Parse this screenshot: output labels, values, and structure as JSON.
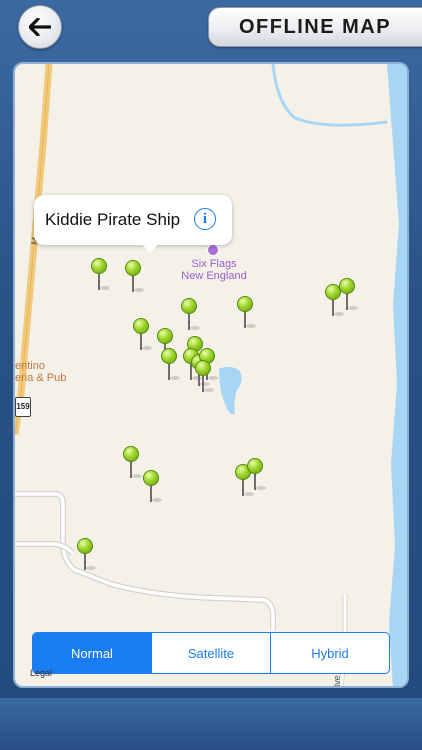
{
  "header": {
    "title": "OFFLINE MAP",
    "back_icon": "arrow-left-icon"
  },
  "map": {
    "callout": {
      "title": "Kiddie Pirate Ship",
      "info_glyph": "i"
    },
    "poi": {
      "label_line1": "Six Flags",
      "label_line2": "New England",
      "color": "#a46fd6"
    },
    "restaurant": {
      "line1": "entino",
      "line2": "eria & Pub"
    },
    "route_shield": "159",
    "road_letter": "M",
    "road_partial": "ive",
    "legal": "Legal"
  },
  "map_type_control": {
    "options": [
      "Normal",
      "Satellite",
      "Hybrid"
    ],
    "selected": "Normal",
    "accent_color": "#1a7cf2"
  },
  "pin_color": "#9dd32a",
  "water_color": "#a7d6f5"
}
